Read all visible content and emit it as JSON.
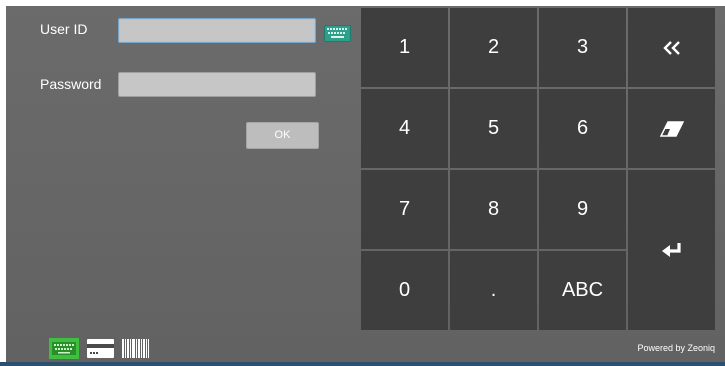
{
  "login": {
    "user_id_label": "User ID",
    "user_id_value": "",
    "password_label": "Password",
    "password_value": "",
    "ok_label": "OK"
  },
  "keypad": {
    "keys": [
      "1",
      "2",
      "3",
      "4",
      "5",
      "6",
      "7",
      "8",
      "9",
      "0",
      ".",
      "ABC"
    ],
    "icons": [
      "double-chevron-left-icon",
      "eraser-icon",
      "enter-icon"
    ]
  },
  "footer": {
    "powered_by": "Powered by Zeoniq",
    "input_modes": [
      "keyboard-icon",
      "card-icon",
      "barcode-icon"
    ],
    "active_mode": "keyboard-icon"
  },
  "colors": {
    "background": "#676767",
    "key": "#3e3e3e",
    "field": "#c6c6c6",
    "active_mode": "#3fbf3f",
    "keyboard_toggle": "#2e9f8a"
  }
}
